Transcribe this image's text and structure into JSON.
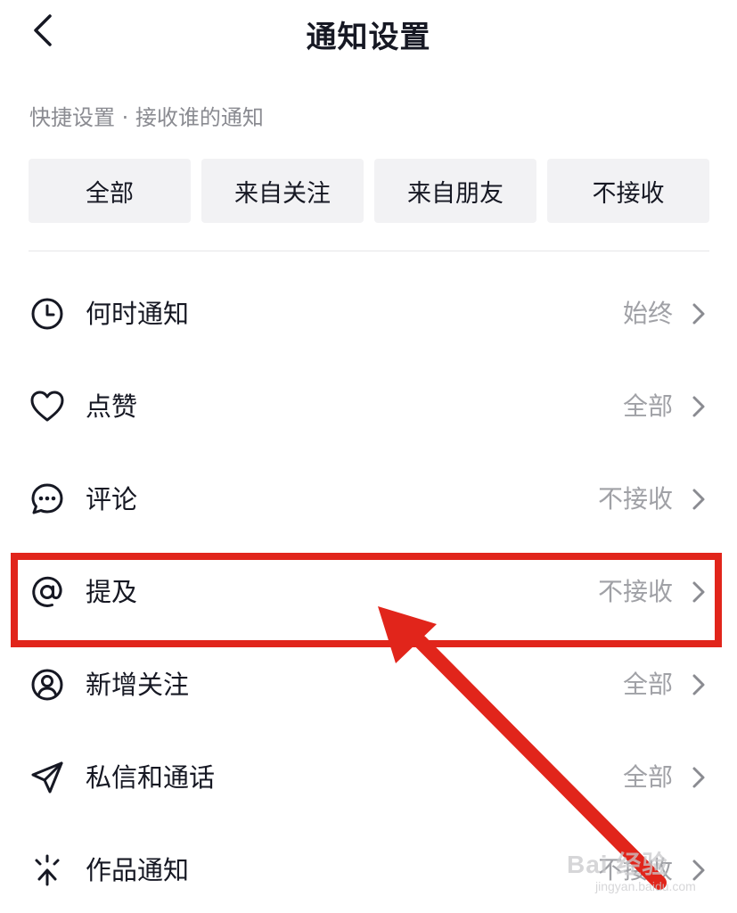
{
  "header": {
    "title": "通知设置"
  },
  "quick_settings": {
    "label": "快捷设置 · 接收谁的通知",
    "options": [
      "全部",
      "来自关注",
      "来自朋友",
      "不接收"
    ]
  },
  "settings": [
    {
      "label": "何时通知",
      "value": "始终",
      "icon": "clock-icon"
    },
    {
      "label": "点赞",
      "value": "全部",
      "icon": "heart-icon"
    },
    {
      "label": "评论",
      "value": "不接收",
      "icon": "comment-icon"
    },
    {
      "label": "提及",
      "value": "不接收",
      "icon": "at-icon"
    },
    {
      "label": "新增关注",
      "value": "全部",
      "icon": "user-icon"
    },
    {
      "label": "私信和通话",
      "value": "全部",
      "icon": "send-icon"
    },
    {
      "label": "作品通知",
      "value": "不接收",
      "icon": "sparkle-icon"
    }
  ],
  "annotation": {
    "highlight_color": "#e1251b"
  },
  "watermark": {
    "main": "Bai 经验",
    "sub": "jingyan.baidu.com"
  }
}
